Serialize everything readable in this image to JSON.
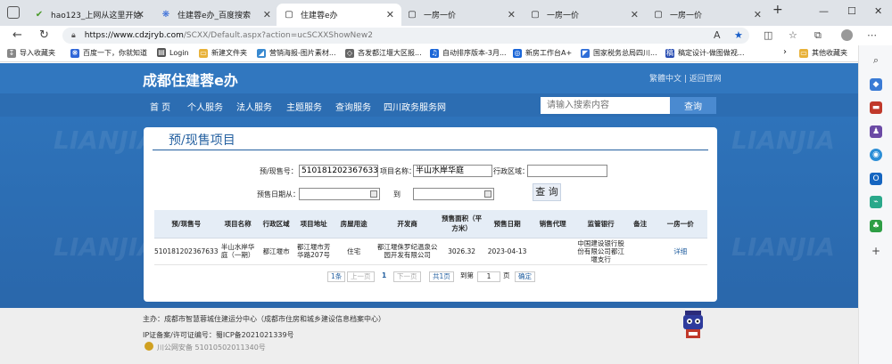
{
  "browser": {
    "tabs": [
      {
        "label": "hao123_上网从这里开始",
        "icon": "hao123-icon"
      },
      {
        "label": "住建蓉e办_百度搜索",
        "icon": "baidu-icon"
      },
      {
        "label": "住建蓉e办",
        "icon": "page-icon",
        "active": true
      },
      {
        "label": "一房一价",
        "icon": "page-icon"
      },
      {
        "label": "一房一价",
        "icon": "page-icon"
      },
      {
        "label": "一房一价",
        "icon": "page-icon"
      }
    ],
    "url_host": "https://www.cdzjryb.com",
    "url_path": "/SCXX/Default.aspx?action=ucSCXXShowNew2",
    "bookmarks": [
      "导入收藏夹",
      "百度一下，你就知道",
      "Login",
      "新建文件夹",
      "营销海报-图片素材...",
      "吝发都江堰大区报...",
      "自动排序版本-3月...",
      "新房工作台A+",
      "国家税务总局四川...",
      "稿定设计-做图做视...",
      "其他收藏夹"
    ]
  },
  "site": {
    "logo": "成都住建蓉e办",
    "top_links": "繁體中文 | 返回官网",
    "nav": [
      "首 页",
      "个人服务",
      "法人服务",
      "主题服务",
      "查询服务",
      "四川政务服务网"
    ],
    "search_placeholder": "请输入搜索内容",
    "search_button": "查询"
  },
  "card": {
    "title": "预/现售项目",
    "form": {
      "presale_no_label": "预/现售号：",
      "presale_no_value": "510181202367633",
      "project_name_label": "项目名称：",
      "project_name_value": "半山水岸华庭",
      "district_label": "行政区域：",
      "district_value": "",
      "presale_date_from_label": "预售日期从：",
      "presale_date_from_value": "",
      "to_label": "到",
      "presale_date_to_value": "",
      "query_button": "查 询"
    },
    "table": {
      "headers": [
        "预/现售号",
        "项目名称",
        "行政区域",
        "项目地址",
        "房屋用途",
        "开发商",
        "预售面积（平方米）",
        "预售日期",
        "销售代理",
        "监管银行",
        "备注",
        "一房一价"
      ],
      "rows": [
        [
          "510181202367633",
          "半山水岸华庭（一期）",
          "都江堰市",
          "都江堰市芳华路207号",
          "住宅",
          "都江堰侏罗纪温泉公园开发有限公司",
          "3026.32",
          "2023-04-13",
          "",
          "中国建设银行股份有限公司都江堰支行",
          "",
          "详细"
        ]
      ]
    },
    "pager": {
      "count": "1条",
      "prev": "上一页",
      "current": "1",
      "next": "下一页",
      "total": "共1页",
      "goto_label": "到第",
      "goto_value": "1",
      "page_unit": "页",
      "confirm": "确定"
    }
  },
  "footer": {
    "host": "主办：成都市智慧蓉城住建运分中心（成都市住房和城乡建设信息档案中心）",
    "icp": "IP证备案/许可证编号：蜀ICP备2021021339号",
    "police": "川公网安备 51010502011340号"
  },
  "watermark": "LIANJIA"
}
